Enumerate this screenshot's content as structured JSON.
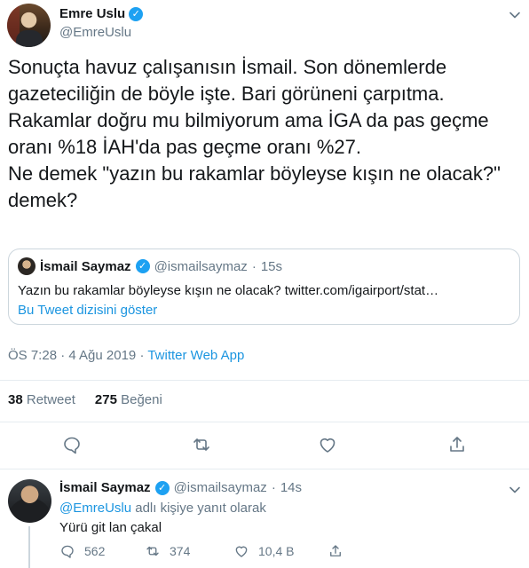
{
  "main_tweet": {
    "author_name": "Emre Uslu",
    "author_handle": "@EmreUslu",
    "verified_mark": "✓",
    "text": "Sonuçta havuz çalışanısın İsmail. Son dönemlerde\ngazeteciliğin de böyle işte.  Bari görüneni çarpıtma.\nRakamlar doğru mu bilmiyorum ama İGA da pas geçme\noranı %18 İAH'da pas geçme oranı %27.\nNe demek \"yazın bu rakamlar böyleyse kışın ne olacak?\"\ndemek?",
    "timestamp": "ÖS 7:28 · 4 Ağu 2019 · ",
    "source": "Twitter Web App",
    "retweet_count": "38",
    "retweet_label": "Retweet",
    "like_count": "275",
    "like_label": "Beğeni",
    "actions": [
      "reply-icon",
      "retweet-icon",
      "like-icon",
      "share-icon"
    ],
    "menu_icon": "chevron-down-icon"
  },
  "quoted_tweet": {
    "author_name": "İsmail Saymaz",
    "verified_mark": "✓",
    "author_handle": "@ismailsaymaz",
    "separator": "·",
    "time": "15s",
    "text": "Yazın bu rakamlar böyleyse kışın ne olacak? twitter.com/igairport/stat…",
    "thread_link": "Bu Tweet dizisini göster"
  },
  "reply_tweet": {
    "author_name": "İsmail Saymaz",
    "verified_mark": "✓",
    "author_handle": "@ismailsaymaz",
    "separator": "·",
    "time": "14s",
    "replying_mention": "@EmreUslu",
    "replying_suffix": " adlı kişiye yanıt olarak",
    "text": "Yürü git lan çakal",
    "reply_count": "562",
    "retweet_count": "374",
    "like_count": "10,4 B",
    "menu_icon": "chevron-down-icon"
  },
  "colors": {
    "accent": "#1da1f2",
    "link": "#1b95e0",
    "secondary_text": "#657786",
    "border": "#e6ecf0"
  }
}
